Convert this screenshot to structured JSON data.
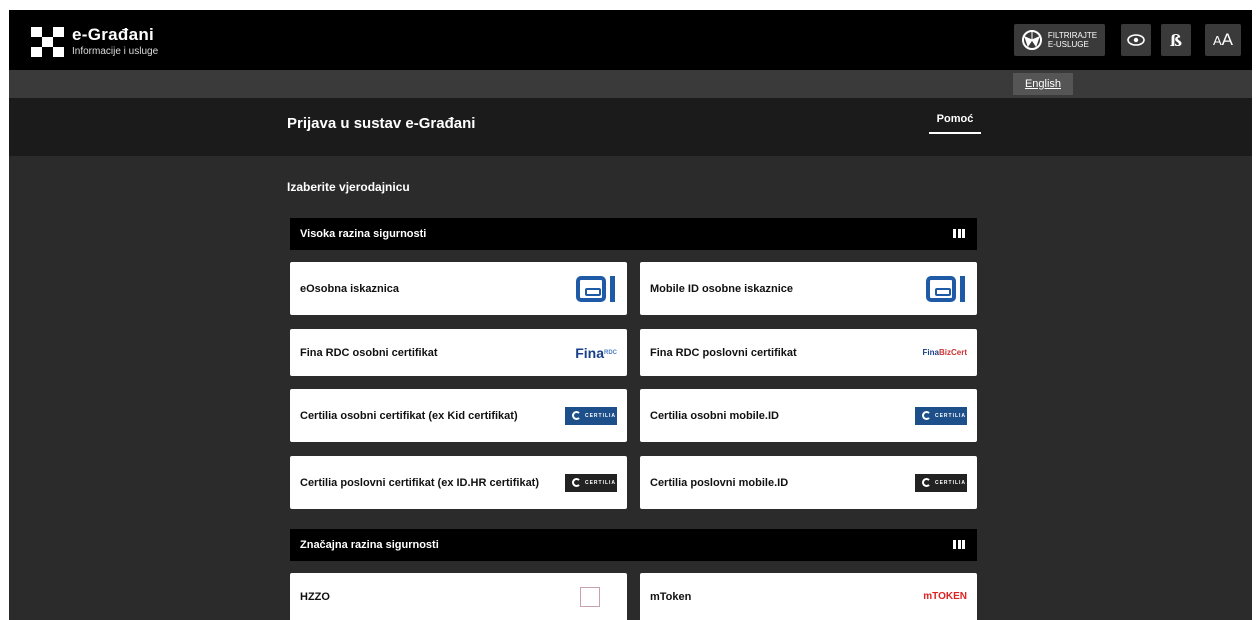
{
  "header": {
    "brand_title": "e-Građani",
    "brand_subtitle": "Informacije i usluge",
    "filter_line1": "FILTRIRAJTE",
    "filter_line2": "E-USLUGE",
    "font_toggle": "ß",
    "text_size_small": "A",
    "text_size_large": "A"
  },
  "language": {
    "label": "English"
  },
  "page": {
    "title": "Prijava u sustav e-Građani",
    "help": "Pomoć",
    "choose_label": "Izaberite vjerodajnicu"
  },
  "sections": [
    {
      "title": "Visoka razina sigurnosti",
      "cards": [
        {
          "label": "eOsobna iskaznica",
          "logo": "eid-logo"
        },
        {
          "label": "Mobile ID osobne iskaznice",
          "logo": "eid-logo"
        },
        {
          "label": "Fina RDC osobni certifikat",
          "logo": "fina-rdc-logo",
          "logo_text": "Fina",
          "logo_sup": "RDC"
        },
        {
          "label": "Fina RDC poslovni certifikat",
          "logo": "fina-bizcert-logo",
          "logo_text": "Fina",
          "logo_sup": "BizCert"
        },
        {
          "label": "Certilia osobni certifikat (ex Kid certifikat)",
          "logo": "certilia-blue-logo",
          "logo_text": "CERTILIA"
        },
        {
          "label": "Certilia osobni mobile.ID",
          "logo": "certilia-blue-logo",
          "logo_text": "CERTILIA"
        },
        {
          "label": "Certilia poslovni certifikat (ex ID.HR certifikat)",
          "logo": "certilia-black-logo",
          "logo_text": "CERTILIA"
        },
        {
          "label": "Certilia poslovni mobile.ID",
          "logo": "certilia-black-logo",
          "logo_text": "CERTILIA"
        }
      ]
    },
    {
      "title": "Značajna razina sigurnosti",
      "cards": [
        {
          "label": "HZZO",
          "logo": "hzzo-logo"
        },
        {
          "label": "mToken",
          "logo": "mtoken-logo",
          "logo_text": "mTOKEN"
        }
      ]
    }
  ],
  "colors": {
    "background": "#2b2b2b",
    "topbar": "#000000",
    "header_band": "#1b1b1b",
    "eid_blue": "#1f5aa6",
    "certilia_blue": "#1d4f8a"
  }
}
